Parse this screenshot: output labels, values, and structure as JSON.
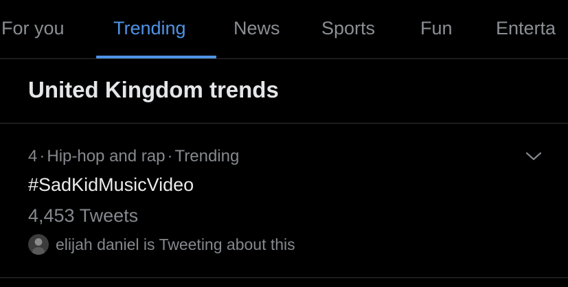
{
  "tabs": [
    {
      "label": "For you",
      "active": false
    },
    {
      "label": "Trending",
      "active": true
    },
    {
      "label": "News",
      "active": false
    },
    {
      "label": "Sports",
      "active": false
    },
    {
      "label": "Fun",
      "active": false
    },
    {
      "label": "Enterta",
      "active": false
    }
  ],
  "section": {
    "title": "United Kingdom trends"
  },
  "trends": [
    {
      "rank": "4",
      "category": "Hip-hop and rap",
      "status": "Trending",
      "separator": "·",
      "name": "#SadKidMusicVideo",
      "count": "4,453 Tweets",
      "context": "elijah daniel is Tweeting about this",
      "more_icon": "chevron-down-icon"
    }
  ],
  "colors": {
    "background": "#000000",
    "accent": "#4f93e6",
    "divider": "#2f3336",
    "secondary_text": "#85898e"
  }
}
